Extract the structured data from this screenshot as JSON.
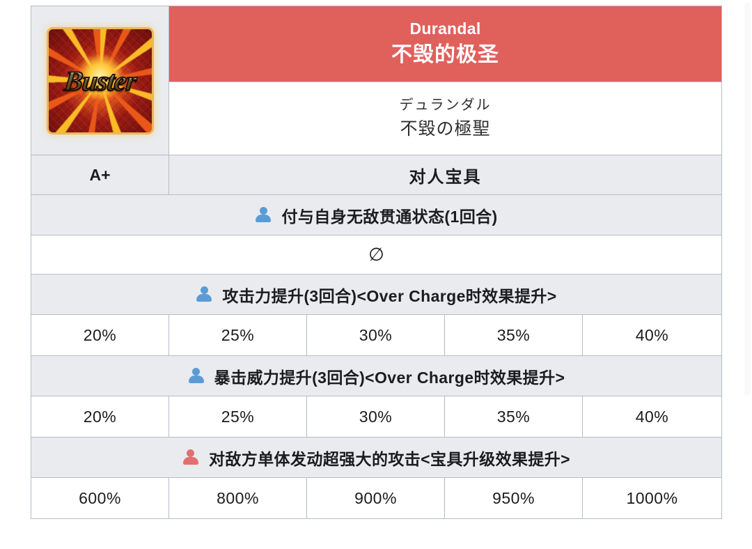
{
  "card": {
    "type_icon": "buster-card-icon",
    "label": "Buster"
  },
  "header": {
    "title_en": "Durandal",
    "title_cn": "不毁的极圣",
    "subtitle_kana": "デュランダル",
    "subtitle_kanji": "不毀の極聖"
  },
  "classification": {
    "rank": "A+",
    "target_type": "对人宝具"
  },
  "symbols": {
    "empty": "∅"
  },
  "effects": [
    {
      "icon": "person-ally-icon",
      "icon_color": "#5b9bd5",
      "target": "ally",
      "text": "付与自身无敌贯通状态(1回合)",
      "values": null
    },
    {
      "icon": null,
      "text": "∅",
      "values": null
    },
    {
      "icon": "person-ally-icon",
      "icon_color": "#5b9bd5",
      "target": "ally",
      "text": "攻击力提升(3回合)<Over Charge时效果提升>",
      "values": [
        "20%",
        "25%",
        "30%",
        "35%",
        "40%"
      ]
    },
    {
      "icon": "person-ally-icon",
      "icon_color": "#5b9bd5",
      "target": "ally",
      "text": "暴击威力提升(3回合)<Over Charge时效果提升>",
      "values": [
        "20%",
        "25%",
        "30%",
        "35%",
        "40%"
      ]
    },
    {
      "icon": "person-enemy-icon",
      "icon_color": "#e2706e",
      "target": "enemy",
      "text": "对敌方单体发动超强大的攻击<宝具升级效果提升>",
      "values": [
        "600%",
        "800%",
        "900%",
        "950%",
        "1000%"
      ]
    }
  ],
  "colors": {
    "header_red": "#e0605c",
    "row_gray": "#e9ebef",
    "border": "#b6bcc4",
    "ally_blue": "#5b9bd5",
    "enemy_red": "#e2706e"
  }
}
